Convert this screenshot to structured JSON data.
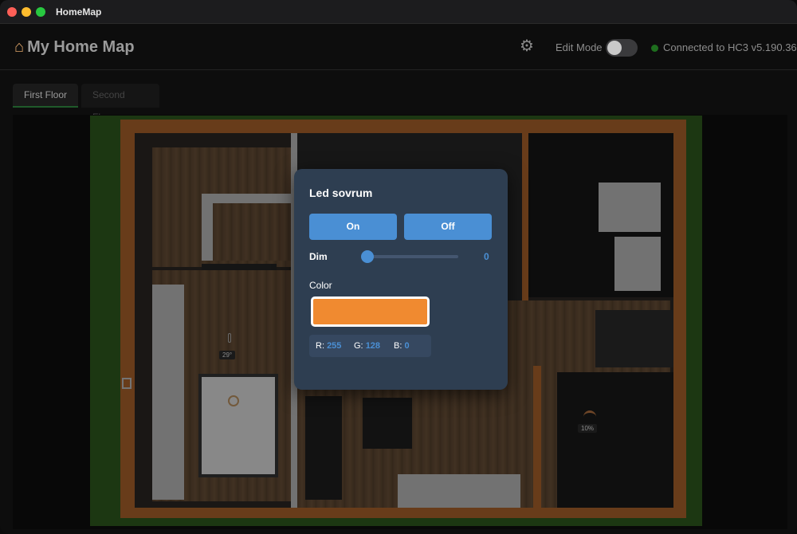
{
  "window": {
    "title": "HomeMap"
  },
  "header": {
    "app_title": "My Home Map",
    "edit_mode_label": "Edit Mode",
    "edit_mode_on": false,
    "connection_status": "Connected to HC3 v5.190.36"
  },
  "tabs": [
    {
      "label": "First Floor",
      "active": true
    },
    {
      "label": "Second Floor",
      "active": false
    }
  ],
  "map": {
    "temperature_label": "29°",
    "shade_label": "10%"
  },
  "popup": {
    "title": "Led sovrum",
    "on_label": "On",
    "off_label": "Off",
    "dim_label": "Dim",
    "dim_value": 0,
    "color_label": "Color",
    "color_hex": "#f08a30",
    "r_label": "R:",
    "r_value": "255",
    "g_label": "G:",
    "g_value": "128",
    "b_label": "B:",
    "b_value": "0"
  },
  "colors": {
    "accent": "#4a8fd4",
    "popup_bg": "#2e3e51",
    "status_dot": "#1e6e1e"
  },
  "icons": {
    "app": "house-icon",
    "settings": "gear-icon",
    "device_bulb": "bulb-icon",
    "device_temp": "thermometer-icon",
    "device_shade": "shade-icon",
    "device_window": "window-icon"
  }
}
